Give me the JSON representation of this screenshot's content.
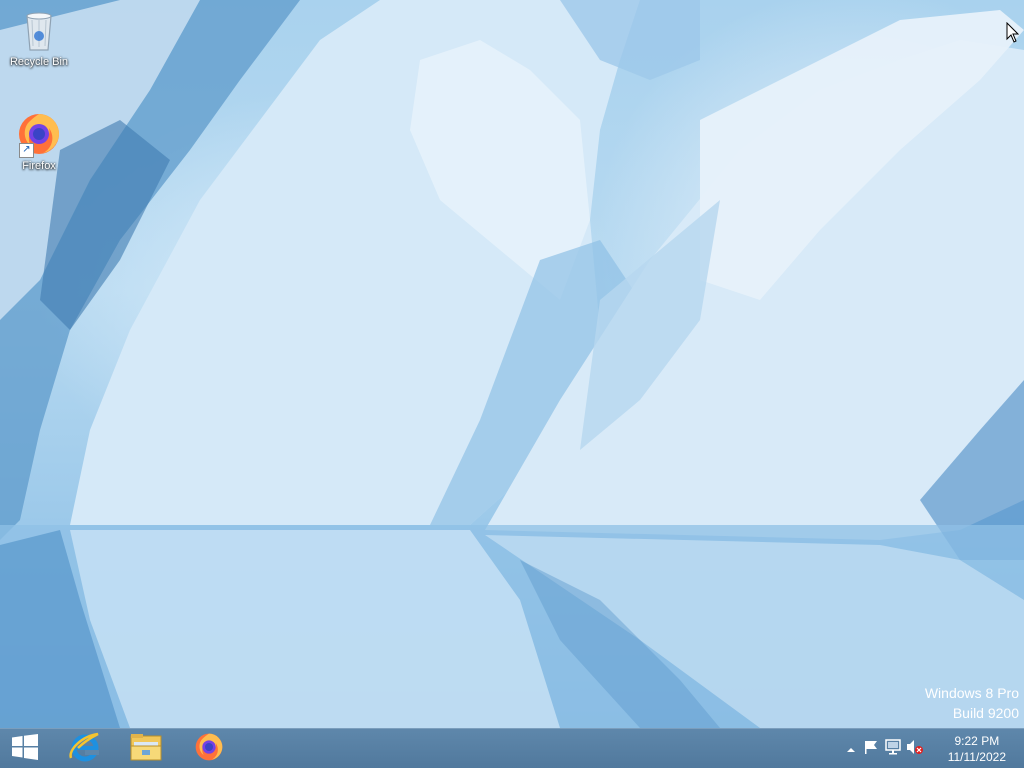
{
  "desktop": {
    "icons": [
      {
        "label": "Recycle Bin",
        "icon": "recycle-bin-icon"
      },
      {
        "label": "Firefox",
        "icon": "firefox-icon"
      }
    ]
  },
  "watermark": {
    "edition": "Windows 8 Pro",
    "build": "Build 9200"
  },
  "taskbar": {
    "start_icon": "windows-logo-icon",
    "pinned": [
      {
        "name": "Internet Explorer",
        "icon": "internet-explorer-icon"
      },
      {
        "name": "File Explorer",
        "icon": "file-explorer-icon"
      },
      {
        "name": "Firefox",
        "icon": "firefox-icon"
      }
    ],
    "tray": {
      "icons": [
        "show-hidden-icons-icon",
        "action-center-flag-icon",
        "network-icon",
        "volume-muted-icon"
      ]
    },
    "clock": {
      "time": "9:22 PM",
      "date": "11/11/2022"
    }
  },
  "colors": {
    "taskbar": "#5a83a7",
    "wallpaper_ice": "#a9d2ee"
  }
}
